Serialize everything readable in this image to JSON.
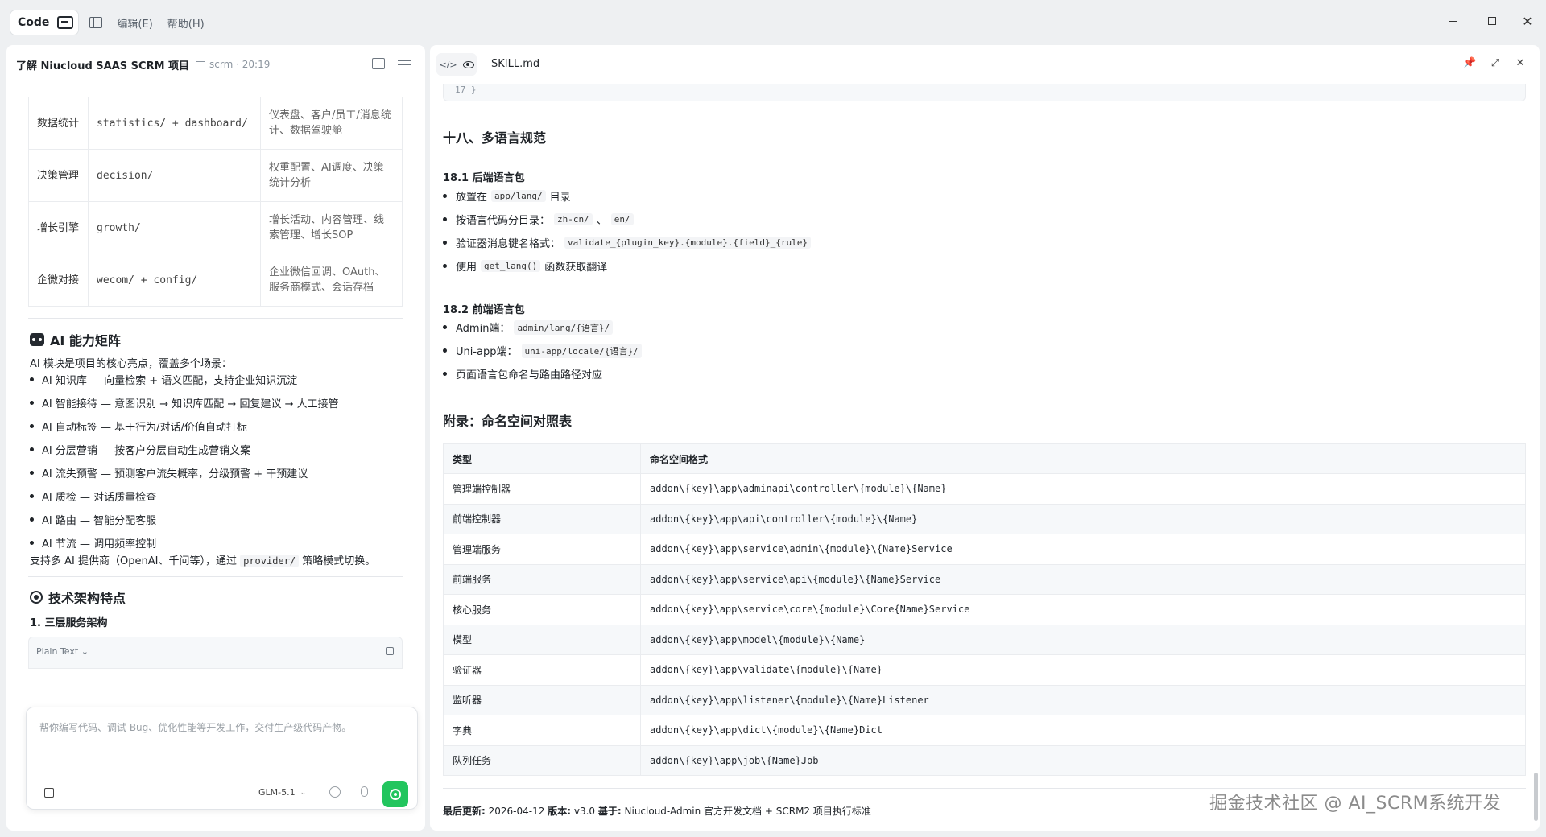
{
  "titlebar": {
    "mode_label": "Code",
    "menu": [
      "编辑(E)",
      "帮助(H)"
    ]
  },
  "left": {
    "title": "了解 Niucloud SAAS SCRM 项目",
    "meta": "scrm · 20:19",
    "table_rows": [
      {
        "name": "数据统计",
        "dir": "statistics/ + dashboard/",
        "desc": "仪表盘、客户/员工/消息统计、数据驾驶舱"
      },
      {
        "name": "决策管理",
        "dir": "decision/",
        "desc": "权重配置、AI调度、决策统计分析"
      },
      {
        "name": "增长引擎",
        "dir": "growth/",
        "desc": "增长活动、内容管理、线索管理、增长SOP"
      },
      {
        "name": "企微对接",
        "dir": "wecom/ + config/",
        "desc": "企业微信回调、OAuth、服务商模式、会话存档"
      }
    ],
    "ai_section_title": "AI 能力矩阵",
    "ai_intro": "AI 模块是项目的核心亮点，覆盖多个场景：",
    "ai_items": [
      "AI 知识库 — 向量检索 + 语义匹配，支持企业知识沉淀",
      "AI 智能接待 — 意图识别 → 知识库匹配 → 回复建议 → 人工接管",
      "AI 自动标签 — 基于行为/对话/价值自动打标",
      "AI 分层营销 — 按客户分层自动生成营销文案",
      "AI 流失预警 — 预测客户流失概率，分级预警 + 干预建议",
      "AI 质检 — 对话质量检查",
      "AI 路由 — 智能分配客服",
      "AI 节流 — 调用频率控制"
    ],
    "provider_text_pre": "支持多 AI 提供商（OpenAI、千问等），通过",
    "provider_code": "provider/",
    "provider_text_post": "策略模式切换。",
    "arch_title": "技术架构特点",
    "arch_sub": "1. 三层服务架构",
    "code_lang": "Plain Text",
    "chat_placeholder": "帮你编写代码、调试 Bug、优化性能等开发工作，交付生产级代码产物。",
    "model": "GLM-5.1"
  },
  "right": {
    "filename": "SKILL.md",
    "code_tail": "17  }",
    "h2_lang": "十八、多语言规范",
    "h3_backend": "18.1 后端语言包",
    "backend_items": [
      {
        "pre": "放置在",
        "code": "app/lang/",
        "post": "目录"
      },
      {
        "pre": "按语言代码分目录：",
        "code": "zh-cn/",
        "mid": "、",
        "code2": "en/",
        "post": ""
      },
      {
        "pre": "验证器消息键名格式：",
        "code": "validate_{plugin_key}.{module}.{field}_{rule}",
        "post": ""
      },
      {
        "pre": "使用",
        "code": "get_lang()",
        "post": "函数获取翻译"
      }
    ],
    "h3_frontend": "18.2 前端语言包",
    "frontend_items": [
      {
        "pre": "Admin端：",
        "code": "admin/lang/{语言}/",
        "post": ""
      },
      {
        "pre": "Uni-app端：",
        "code": "uni-app/locale/{语言}/",
        "post": ""
      },
      {
        "pre": "页面语言包命名与路由路径对应",
        "code": "",
        "post": ""
      }
    ],
    "h2_appendix": "附录：命名空间对照表",
    "table_headers": [
      "类型",
      "命名空间格式"
    ],
    "table_rows": [
      [
        "管理端控制器",
        "addon\\{key}\\app\\adminapi\\controller\\{module}\\{Name}"
      ],
      [
        "前端控制器",
        "addon\\{key}\\app\\api\\controller\\{module}\\{Name}"
      ],
      [
        "管理端服务",
        "addon\\{key}\\app\\service\\admin\\{module}\\{Name}Service"
      ],
      [
        "前端服务",
        "addon\\{key}\\app\\service\\api\\{module}\\{Name}Service"
      ],
      [
        "核心服务",
        "addon\\{key}\\app\\service\\core\\{module}\\Core{Name}Service"
      ],
      [
        "模型",
        "addon\\{key}\\app\\model\\{module}\\{Name}"
      ],
      [
        "验证器",
        "addon\\{key}\\app\\validate\\{module}\\{Name}"
      ],
      [
        "监听器",
        "addon\\{key}\\app\\listener\\{module}\\{Name}Listener"
      ],
      [
        "字典",
        "addon\\{key}\\app\\dict\\{module}\\{Name}Dict"
      ],
      [
        "队列任务",
        "addon\\{key}\\app\\job\\{Name}Job"
      ]
    ],
    "footer": {
      "updated_label": "最后更新:",
      "updated_value": "2026-04-12",
      "version_label": "版本:",
      "version_value": "v3.0",
      "based_label": "基于:",
      "based_value": "Niucloud-Admin 官方开发文档 + SCRM2 项目执行标准"
    }
  },
  "watermark": "掘金技术社区 @ AI_SCRM系统开发"
}
